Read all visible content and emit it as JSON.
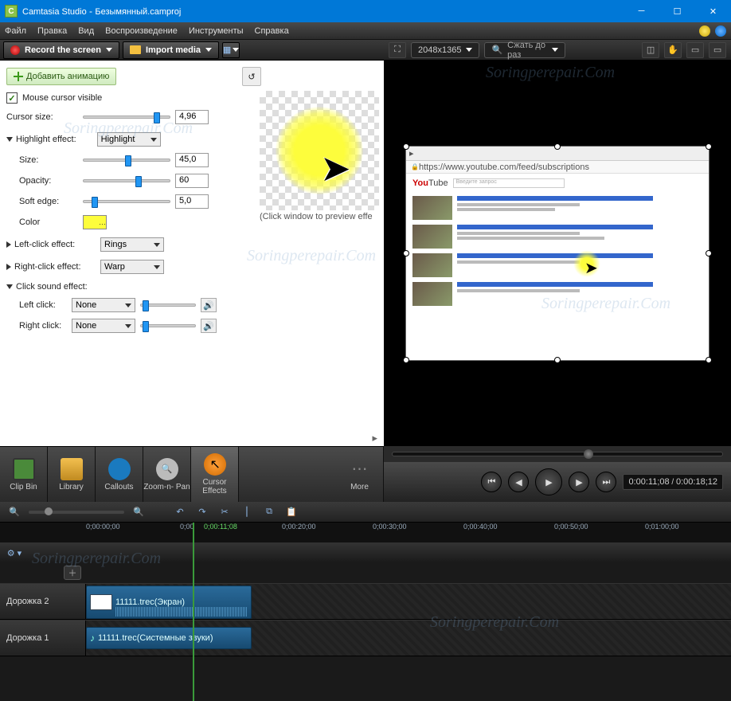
{
  "title": {
    "app": "Camtasia Studio",
    "file": "Безымянный.camproj"
  },
  "menu": [
    "Файл",
    "Правка",
    "Вид",
    "Воспроизведение",
    "Инструменты",
    "Справка"
  ],
  "toolbar": {
    "record": "Record the screen",
    "import": "Import media"
  },
  "preview": {
    "dimensions": "2048x1365",
    "search": "Сжать до раз"
  },
  "props": {
    "add_animation": "Добавить анимацию",
    "cursor_visible": "Mouse cursor visible",
    "cursor_size": "Cursor size:",
    "cursor_size_val": "4,96",
    "highlight": "Highlight effect:",
    "highlight_mode": "Highlight",
    "size": "Size:",
    "size_val": "45,0",
    "opacity": "Opacity:",
    "opacity_val": "60",
    "soft": "Soft edge:",
    "soft_val": "5,0",
    "color": "Color",
    "left_click": "Left-click effect:",
    "left_click_val": "Rings",
    "right_click": "Right-click effect:",
    "right_click_val": "Warp",
    "sound": "Click sound effect:",
    "left_snd": "Left click:",
    "right_snd": "Right click:",
    "none": "None",
    "preview_caption": "(Click window to preview effe"
  },
  "tabs": {
    "clipbin": "Clip Bin",
    "library": "Library",
    "callouts": "Callouts",
    "zoom": "Zoom-n-\nPan",
    "cursor": "Cursor\nEffects",
    "more": "More"
  },
  "player": {
    "current": "0:00:11;08",
    "total": "0:00:18;12"
  },
  "video": {
    "url": "https://www.youtube.com/feed/subscriptions",
    "yt_prefix": "You",
    "yt_suffix": "Tube",
    "search_ph": "Введите запрос"
  },
  "timeline": {
    "ticks": [
      "0;00:00;00",
      "0;00",
      "0;00:11;08",
      "0;00:20;00",
      "0;00:30;00",
      "0;00:40;00",
      "0;00:50;00",
      "0;01:00;00"
    ],
    "track2": "Дорожка 2",
    "track1": "Дорожка 1",
    "clip_video": "11111.trec(Экран)",
    "clip_audio": "11111.trec(Системные звуки)"
  }
}
